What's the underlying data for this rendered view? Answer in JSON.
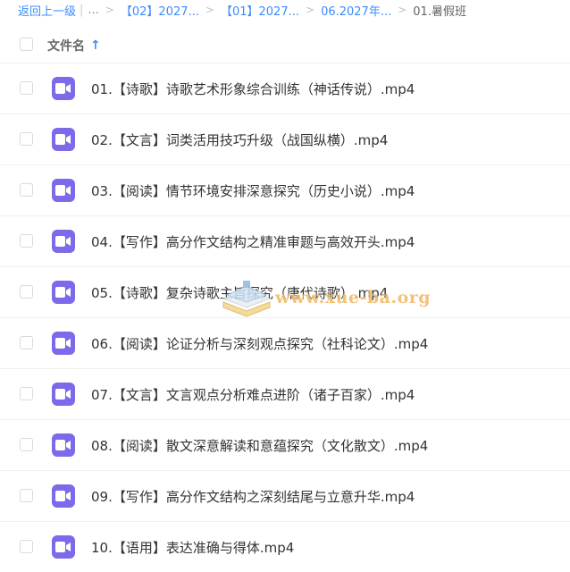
{
  "breadcrumb": {
    "back_label": "返回上一级",
    "bar": "|",
    "ellipsis": "...",
    "separator": ">",
    "items": [
      "【02】2027...",
      "【01】2027...",
      "06.2027年..."
    ],
    "current": "01.暑假班"
  },
  "header": {
    "column_label": "文件名",
    "sort_icon": "arrow-up-icon"
  },
  "files": [
    {
      "name": "01.【诗歌】诗歌艺术形象综合训练（神话传说）.mp4"
    },
    {
      "name": "02.【文言】词类活用技巧升级（战国纵横）.mp4"
    },
    {
      "name": "03.【阅读】情节环境安排深意探究（历史小说）.mp4"
    },
    {
      "name": "04.【写作】高分作文结构之精准审题与高效开头.mp4"
    },
    {
      "name": "05.【诗歌】复杂诗歌主旨探究（唐代诗歌）.mp4"
    },
    {
      "name": "06.【阅读】论证分析与深刻观点探究（社科论文）.mp4"
    },
    {
      "name": "07.【文言】文言观点分析难点进阶（诸子百家）.mp4"
    },
    {
      "name": "08.【阅读】散文深意解读和意蕴探究（文化散文）.mp4"
    },
    {
      "name": "09.【写作】高分作文结构之深刻结尾与立意升华.mp4"
    },
    {
      "name": "10.【语用】表达准确与得体.mp4"
    }
  ],
  "file_icon": "video-file-icon",
  "watermark": {
    "text": "www.xue-ba.org"
  },
  "colors": {
    "accent": "#3b8cff",
    "video_icon": "#7b6bea",
    "watermark": "#f0b860"
  }
}
